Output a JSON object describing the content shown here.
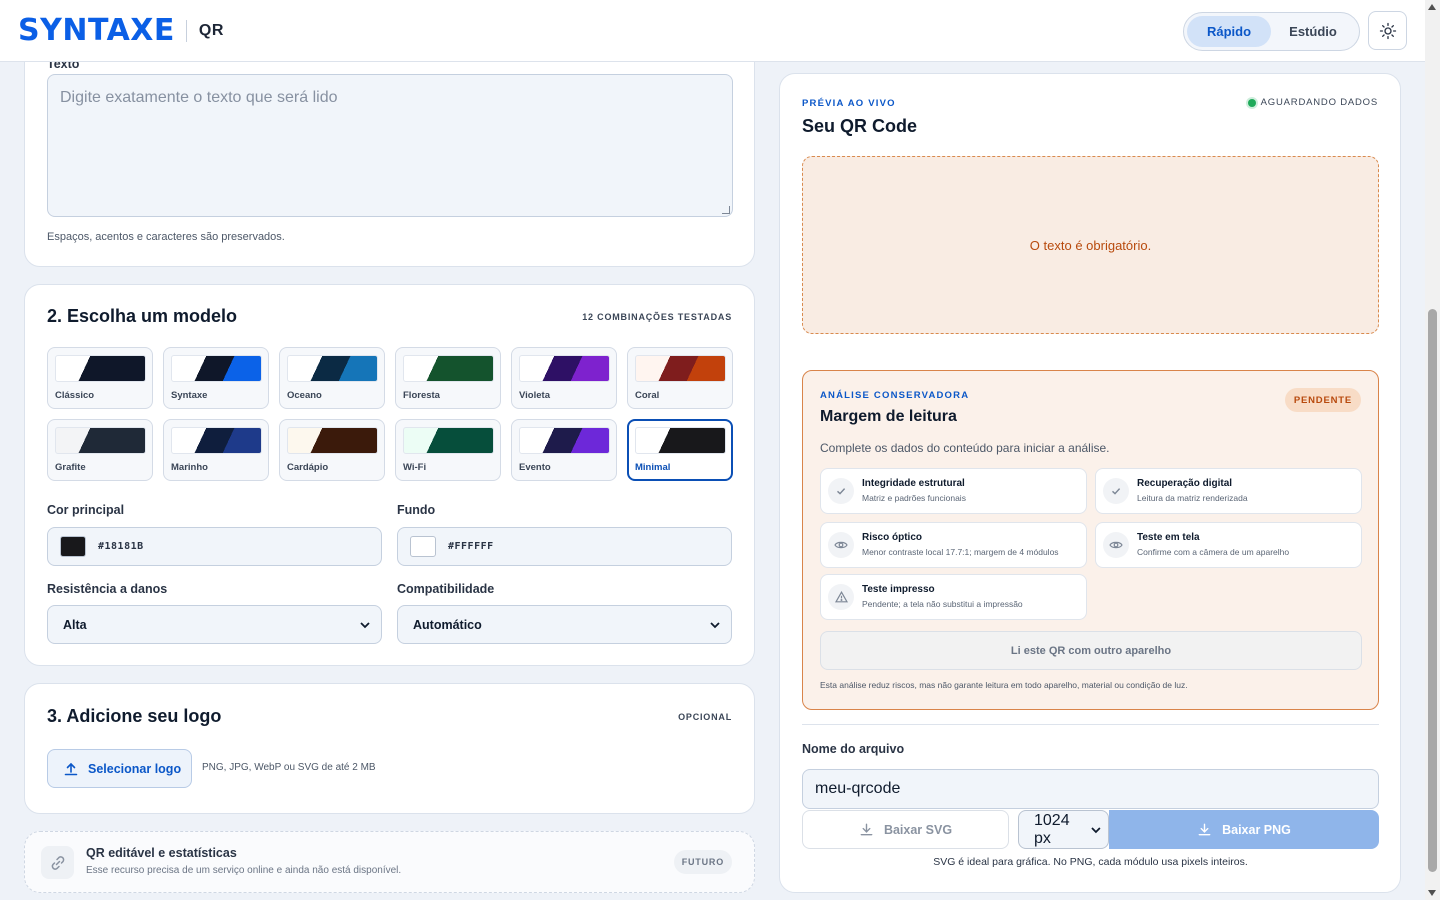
{
  "header": {
    "brand": "SYNTAXE",
    "product": "QR",
    "modes": [
      "Rápido",
      "Estúdio"
    ],
    "active_mode": "Rápido",
    "theme_icon": "sun-icon"
  },
  "step1": {
    "field_label": "Texto",
    "placeholder": "Digite exatamente o texto que será lido",
    "hint": "Espaços, acentos e caracteres são preservados."
  },
  "step2": {
    "title": "2. Escolha um modelo",
    "tag": "12 COMBINAÇÕES TESTADAS",
    "templates": [
      {
        "name": "Clássico",
        "c1": "#ffffff",
        "c2": "#0f1729",
        "c3": "#0f1729"
      },
      {
        "name": "Syntaxe",
        "c1": "#ffffff",
        "c2": "#0f1729",
        "c3": "#0b62e8"
      },
      {
        "name": "Oceano",
        "c1": "#ffffff",
        "c2": "#0b2a44",
        "c3": "#1575b8"
      },
      {
        "name": "Floresta",
        "c1": "#ffffff",
        "c2": "#14532d",
        "c3": "#14532d"
      },
      {
        "name": "Violeta",
        "c1": "#ffffff",
        "c2": "#2e1065",
        "c3": "#7e22ce"
      },
      {
        "name": "Coral",
        "c1": "#fff5f0",
        "c2": "#7f1d1d",
        "c3": "#c2410c"
      },
      {
        "name": "Grafite",
        "c1": "#f3f4f6",
        "c2": "#1f2937",
        "c3": "#1f2937"
      },
      {
        "name": "Marinho",
        "c1": "#ffffff",
        "c2": "#0f1e3d",
        "c3": "#1e3a8a"
      },
      {
        "name": "Cardápio",
        "c1": "#fdf8ee",
        "c2": "#3b1a0b",
        "c3": "#3b1a0b"
      },
      {
        "name": "Wi-Fi",
        "c1": "#ecfdf5",
        "c2": "#064e3b",
        "c3": "#064e3b"
      },
      {
        "name": "Evento",
        "c1": "#ffffff",
        "c2": "#1e1b4b",
        "c3": "#6d28d9"
      },
      {
        "name": "Minimal",
        "c1": "#ffffff",
        "c2": "#18181b",
        "c3": "#18181b"
      }
    ],
    "selected_template": "Minimal",
    "main_color_label": "Cor principal",
    "main_color": "#18181B",
    "background_label": "Fundo",
    "background_color": "#FFFFFF",
    "damage_label": "Resistência a danos",
    "damage_value": "Alta",
    "compat_label": "Compatibilidade",
    "compat_value": "Automático"
  },
  "step3": {
    "title": "3. Adicione seu logo",
    "tag": "OPCIONAL",
    "button": "Selecionar logo",
    "hint": "PNG, JPG, WebP ou SVG de até 2 MB"
  },
  "future": {
    "title": "QR editável e estatísticas",
    "subtitle": "Esse recurso precisa de um serviço online e ainda não está disponível.",
    "badge": "FUTURO"
  },
  "preview": {
    "kicker": "PRÉVIA AO VIVO",
    "status": "AGUARDANDO DADOS",
    "status_color": "#1faa5a",
    "title": "Seu QR Code",
    "error": "O texto é obrigatório."
  },
  "analysis": {
    "kicker": "ANÁLISE CONSERVADORA",
    "badge": "PENDENTE",
    "title": "Margem de leitura",
    "description": "Complete os dados do conteúdo para iniciar a análise.",
    "checks": [
      {
        "title": "Integridade estrutural",
        "subtitle": "Matriz e padrões funcionais",
        "icon": "check-icon"
      },
      {
        "title": "Recuperação digital",
        "subtitle": "Leitura da matriz renderizada",
        "icon": "check-icon"
      },
      {
        "title": "Risco óptico",
        "subtitle": "Menor contraste local 17.7:1; margem de 4 módulos",
        "icon": "eye-icon"
      },
      {
        "title": "Teste em tela",
        "subtitle": "Confirme com a câmera de um aparelho",
        "icon": "eye-icon"
      },
      {
        "title": "Teste impresso",
        "subtitle": "Pendente; a tela não substitui a impressão",
        "icon": "warning-icon"
      }
    ],
    "verify_button": "Li este QR com outro aparelho",
    "footnote": "Esta análise reduz riscos, mas não garante leitura em todo aparelho, material ou condição de luz."
  },
  "export": {
    "file_label": "Nome do arquivo",
    "file_value": "meu-qrcode",
    "svg_button": "Baixar SVG",
    "size_value": "1024 px",
    "png_button": "Baixar PNG",
    "hint": "SVG é ideal para gráfica. No PNG, cada módulo usa pixels inteiros."
  }
}
